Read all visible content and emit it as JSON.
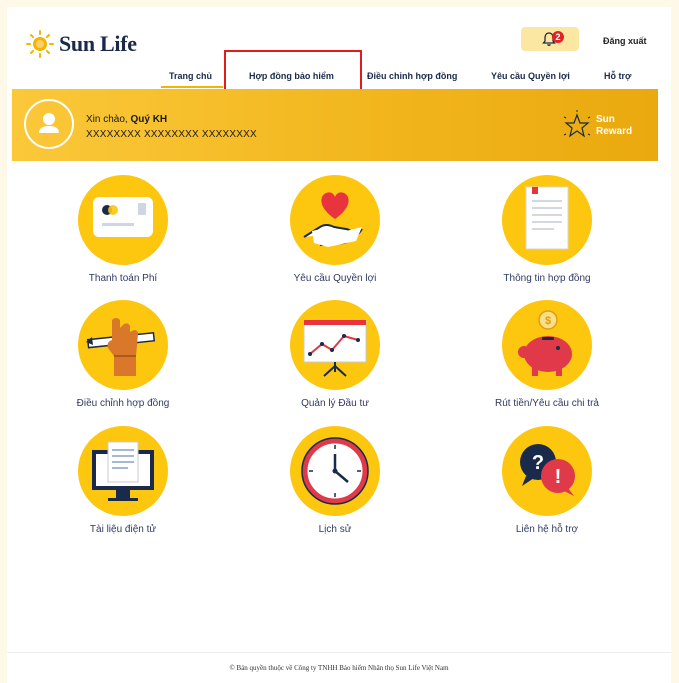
{
  "header": {
    "brand": "Sun Life",
    "notification_count": "2",
    "logout_label": "Đăng xuất"
  },
  "nav": {
    "items": [
      {
        "label": "Trang chủ"
      },
      {
        "label": "Hợp đồng bảo hiểm"
      },
      {
        "label": "Điều chỉnh hợp đồng"
      },
      {
        "label": "Yêu cầu Quyền lợi"
      },
      {
        "label": "Hỗ trợ"
      }
    ]
  },
  "banner": {
    "greeting_prefix": "Xin chào,",
    "user_name": "Quý KH",
    "account_number": "XXXXXXXX XXXXXXXX XXXXXXXX",
    "reward_line1": "Sun",
    "reward_line2": "Reward"
  },
  "tiles": [
    {
      "label": "Thanh toán Phí",
      "icon": "payment-card-icon"
    },
    {
      "label": "Yêu cầu Quyền lợi",
      "icon": "heart-hand-icon"
    },
    {
      "label": "Thông tin hợp đồng",
      "icon": "document-icon"
    },
    {
      "label": "Điều chỉnh hợp đồng",
      "icon": "hand-pencil-icon"
    },
    {
      "label": "Quản lý Đầu tư",
      "icon": "chart-board-icon"
    },
    {
      "label": "Rút tiền/Yêu cầu chi trả",
      "icon": "piggy-bank-icon"
    },
    {
      "label": "Tài liệu điện tử",
      "icon": "monitor-document-icon"
    },
    {
      "label": "Lịch sử",
      "icon": "clock-icon"
    },
    {
      "label": "Liên hệ hỗ trợ",
      "icon": "question-alert-icon"
    }
  ],
  "footer": {
    "copyright": "© Bản quyền thuộc về Công ty TNHH Bảo hiểm Nhân thọ Sun Life Việt Nam"
  },
  "colors": {
    "brand_yellow": "#fcc70e",
    "navy": "#1a2a4a",
    "highlight_red": "#e01c1c"
  }
}
